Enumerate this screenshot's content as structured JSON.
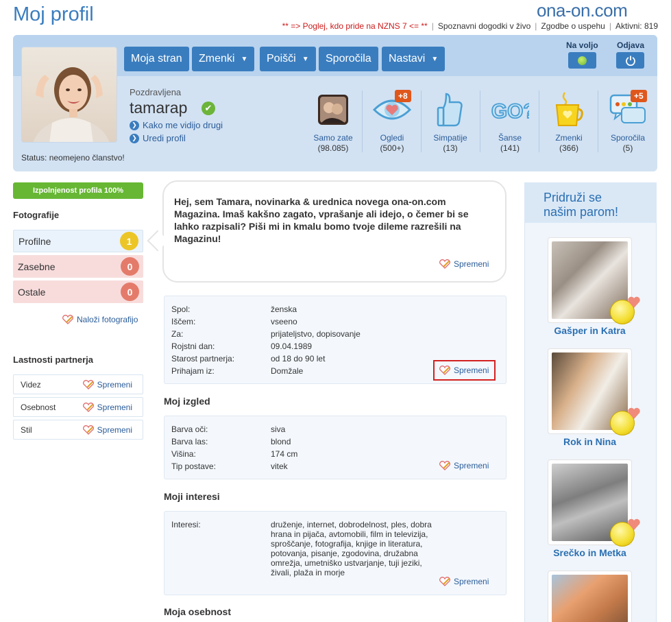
{
  "header": {
    "title": "Moj profil",
    "logo": "ona-on.com",
    "nav": {
      "promo": "** => Poglej, kdo pride na NZNS 7 <= **",
      "events": "Spoznavni dogodki v živo",
      "stories": "Zgodbe o uspehu",
      "active": "Aktivni: 819"
    }
  },
  "menu": {
    "my_page": "Moja stran",
    "dates": "Zmenki",
    "search": "Poišči",
    "messages": "Sporočila",
    "settings": "Nastavi",
    "available": "Na voljo",
    "logout": "Odjava"
  },
  "profile": {
    "greeting": "Pozdravljena",
    "username": "tamarap",
    "view_as_others": "Kako me vidijo drugi",
    "edit_profile": "Uredi profil",
    "status": "Status: neomejeno članstvo!"
  },
  "stats": [
    {
      "label": "Samo zate",
      "count": "(98.085)",
      "icon": "couple-photo-icon"
    },
    {
      "label": "Ogledi",
      "count": "(500+)",
      "badge": "+8",
      "icon": "eye-heart-icon"
    },
    {
      "label": "Simpatije",
      "count": "(13)",
      "icon": "thumbs-up-icon"
    },
    {
      "label": "Šanse",
      "count": "(141)",
      "icon": "go-icon"
    },
    {
      "label": "Zmenki",
      "count": "(366)",
      "icon": "coffee-cup-icon"
    },
    {
      "label": "Sporočila",
      "count": "(5)",
      "badge": "+5",
      "icon": "chat-bubbles-icon"
    }
  ],
  "left": {
    "completion": "Izpolnjenost profila 100%",
    "photos_title": "Fotografije",
    "photos": [
      {
        "label": "Profilne",
        "count": "1"
      },
      {
        "label": "Zasebne",
        "count": "0"
      },
      {
        "label": "Ostale",
        "count": "0"
      }
    ],
    "upload": "Naloži fotografijo",
    "partner_title": "Lastnosti partnerja",
    "partner": [
      {
        "label": "Videz",
        "edit": "Spremeni"
      },
      {
        "label": "Osebnost",
        "edit": "Spremeni"
      },
      {
        "label": "Stil",
        "edit": "Spremeni"
      }
    ]
  },
  "main": {
    "bubble": "Hej, sem Tamara, novinarka & urednica novega ona-on.com Magazina. Imaš kakšno zagato, vprašanje ali idejo, o čemer bi se lahko razpisali? Piši mi in kmalu bomo tvoje dileme razrešili na Magazinu!",
    "edit": "Spremeni",
    "basic": [
      {
        "label": "Spol:",
        "value": "ženska"
      },
      {
        "label": "Iščem:",
        "value": "vseeno"
      },
      {
        "label": "Za:",
        "value": "prijateljstvo, dopisovanje"
      },
      {
        "label": "Rojstni dan:",
        "value": "09.04.1989"
      },
      {
        "label": "Starost partnerja:",
        "value": "od 18 do 90 let"
      },
      {
        "label": "Prihajam iz:",
        "value": "Domžale"
      }
    ],
    "looks_title": "Moj izgled",
    "looks": [
      {
        "label": "Barva oči:",
        "value": "siva"
      },
      {
        "label": "Barva las:",
        "value": "blond"
      },
      {
        "label": "Višina:",
        "value": "174 cm"
      },
      {
        "label": "Tip postave:",
        "value": "vitek"
      }
    ],
    "interests_title": "Moji interesi",
    "interests_label": "Interesi:",
    "interests_lines": [
      "druženje, internet, dobrodelnost, ples, dobra",
      "hrana in pijača, avtomobili, film in televizija,",
      "sproščanje, fotografija, knjige in literatura,",
      "potovanja, pisanje, zgodovina, družabna",
      "omrežja, umetniško ustvarjanje, tuji jeziki,",
      "živali, plaža in morje"
    ],
    "personality_title": "Moja osebnost"
  },
  "right": {
    "title_line1": "Pridruži se",
    "title_line2": "našim parom!",
    "couples": [
      {
        "name": "Gašper in Katra"
      },
      {
        "name": "Rok in Nina"
      },
      {
        "name": "Srečko in Metka"
      }
    ]
  },
  "colors": {
    "accent": "#3a7dbf",
    "panel": "#d2e2f3",
    "green": "#67b734",
    "badge": "#e0571c",
    "alert": "#d42020"
  }
}
